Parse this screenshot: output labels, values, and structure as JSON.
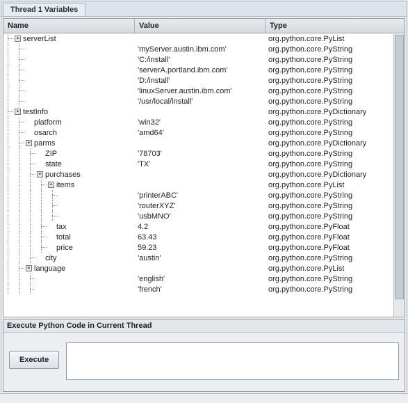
{
  "tab": {
    "label": "Thread 1 Variables"
  },
  "columns": {
    "name": "Name",
    "value": "Value",
    "type": "Type"
  },
  "rows": [
    {
      "indent": 0,
      "toggle": "open",
      "name": "serverList",
      "value": "",
      "type": "org.python.core.PyList"
    },
    {
      "indent": 1,
      "toggle": "none",
      "name": "",
      "value": "'myServer.austin.ibm.com'",
      "type": "org.python.core.PyString"
    },
    {
      "indent": 1,
      "toggle": "none",
      "name": "",
      "value": "'C:/install'",
      "type": "org.python.core.PyString"
    },
    {
      "indent": 1,
      "toggle": "none",
      "name": "",
      "value": "'serverA.portland.ibm.com'",
      "type": "org.python.core.PyString"
    },
    {
      "indent": 1,
      "toggle": "none",
      "name": "",
      "value": "'D:/install'",
      "type": "org.python.core.PyString"
    },
    {
      "indent": 1,
      "toggle": "none",
      "name": "",
      "value": "'linuxServer.austin.ibm.com'",
      "type": "org.python.core.PyString"
    },
    {
      "indent": 1,
      "toggle": "none",
      "name": "",
      "value": "'/usr/local/install'",
      "type": "org.python.core.PyString"
    },
    {
      "indent": 0,
      "toggle": "open",
      "name": "testInfo",
      "value": "",
      "type": "org.python.core.PyDictionary"
    },
    {
      "indent": 1,
      "toggle": "none",
      "name": "platform",
      "value": "'win32'",
      "type": "org.python.core.PyString"
    },
    {
      "indent": 1,
      "toggle": "none",
      "name": "osarch",
      "value": "'amd64'",
      "type": "org.python.core.PyString"
    },
    {
      "indent": 1,
      "toggle": "open",
      "name": "parms",
      "value": "",
      "type": "org.python.core.PyDictionary"
    },
    {
      "indent": 2,
      "toggle": "none",
      "name": "ZIP",
      "value": "'78703'",
      "type": "org.python.core.PyString"
    },
    {
      "indent": 2,
      "toggle": "none",
      "name": "state",
      "value": "'TX'",
      "type": "org.python.core.PyString"
    },
    {
      "indent": 2,
      "toggle": "open",
      "name": "purchases",
      "value": "",
      "type": "org.python.core.PyDictionary"
    },
    {
      "indent": 3,
      "toggle": "open",
      "name": "items",
      "value": "",
      "type": "org.python.core.PyList"
    },
    {
      "indent": 4,
      "toggle": "none",
      "name": "",
      "value": "'printerABC'",
      "type": "org.python.core.PyString"
    },
    {
      "indent": 4,
      "toggle": "none",
      "name": "",
      "value": "'routerXYZ'",
      "type": "org.python.core.PyString"
    },
    {
      "indent": 4,
      "toggle": "none",
      "name": "",
      "value": "'usbMNO'",
      "type": "org.python.core.PyString"
    },
    {
      "indent": 3,
      "toggle": "none",
      "name": "tax",
      "value": "4.2",
      "type": "org.python.core.PyFloat"
    },
    {
      "indent": 3,
      "toggle": "none",
      "name": "total",
      "value": "63.43",
      "type": "org.python.core.PyFloat"
    },
    {
      "indent": 3,
      "toggle": "none",
      "name": "price",
      "value": "59.23",
      "type": "org.python.core.PyFloat"
    },
    {
      "indent": 2,
      "toggle": "none",
      "name": "city",
      "value": "'austin'",
      "type": "org.python.core.PyString"
    },
    {
      "indent": 1,
      "toggle": "open",
      "name": "language",
      "value": "",
      "type": "org.python.core.PyList"
    },
    {
      "indent": 2,
      "toggle": "none",
      "name": "",
      "value": "'english'",
      "type": "org.python.core.PyString"
    },
    {
      "indent": 2,
      "toggle": "none",
      "name": "",
      "value": "'french'",
      "type": "org.python.core.PyString"
    }
  ],
  "exec": {
    "title": "Execute Python Code in Current Thread",
    "button": "Execute",
    "placeholder": ""
  }
}
